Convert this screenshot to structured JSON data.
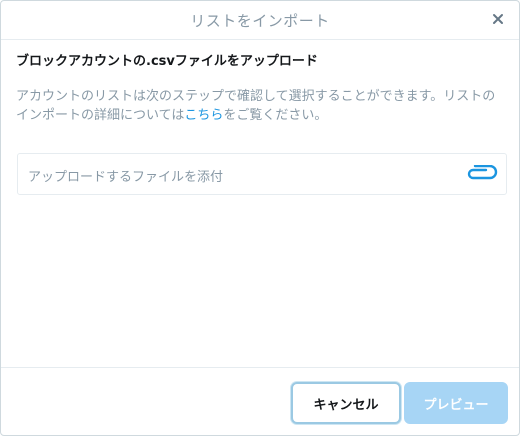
{
  "dialog": {
    "title": "リストをインポート",
    "close_icon": "close-icon"
  },
  "content": {
    "heading": "ブロックアカウントの.csvファイルをアップロード",
    "description_before_link": "アカウントのリストは次のステップで確認して選択することができます。リストのインポートの詳細については",
    "description_link": "こちら",
    "description_after_link": "をご覧ください。",
    "attach_placeholder": "アップロードするファイルを添付",
    "attach_icon": "paperclip-icon"
  },
  "footer": {
    "cancel_label": "キャンセル",
    "preview_label": "プレビュー"
  },
  "colors": {
    "link": "#1b95e0",
    "muted_text": "#8899a6",
    "preview_button_disabled": "#a7d5f5"
  }
}
